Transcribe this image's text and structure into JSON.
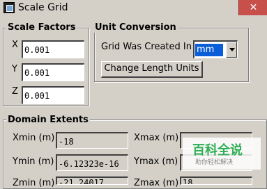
{
  "window": {
    "title": "Scale Grid",
    "close_label": "✕"
  },
  "scale_factors": {
    "title": "Scale Factors",
    "x": {
      "label": "X",
      "value": "0.001"
    },
    "y": {
      "label": "Y",
      "value": "0.001"
    },
    "z": {
      "label": "Z",
      "value": "0.001"
    }
  },
  "unit_conversion": {
    "title": "Unit Conversion",
    "grid_created_label": "Grid Was Created In",
    "unit_value": "mm",
    "change_units_button": "Change Length Units"
  },
  "domain_extents": {
    "title": "Domain Extents",
    "xmin": {
      "label": "Xmin (m)",
      "value": "-18"
    },
    "xmax": {
      "label": "Xmax (m)",
      "value": ""
    },
    "ymin": {
      "label": "Ymin (m)",
      "value": "-6.12323e-16"
    },
    "ymax": {
      "label": "Ymax (m)",
      "value": ""
    },
    "zmin": {
      "label": "Zmin (m)",
      "value": "-21.24017"
    },
    "zmax": {
      "label": "Zmax (m)",
      "value": "18"
    }
  },
  "watermark": {
    "main": "百科全说",
    "sub": "助你轻松解决"
  }
}
